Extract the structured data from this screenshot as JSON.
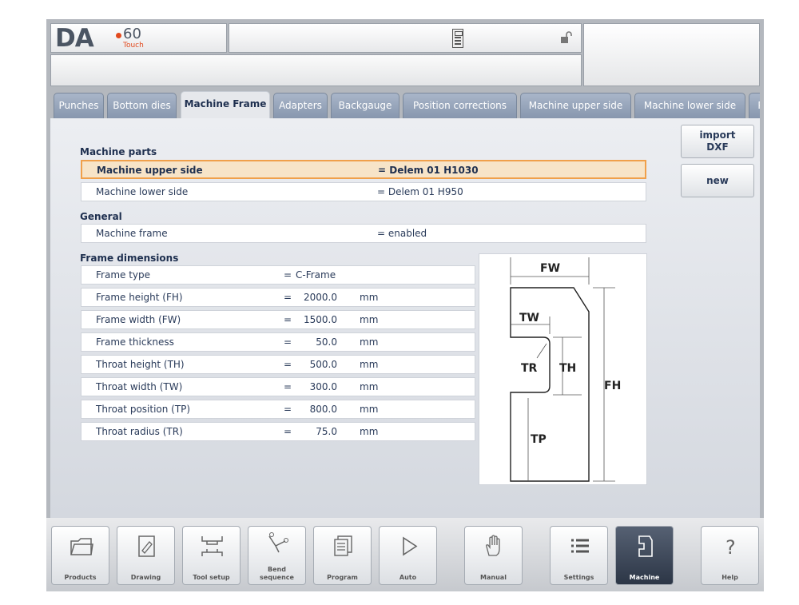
{
  "header": {
    "logo_text": "DA",
    "logo_model": "60",
    "logo_sub": "Touch"
  },
  "tabs": [
    {
      "label": "Punches"
    },
    {
      "label": "Bottom dies"
    },
    {
      "label": "Machine Frame",
      "active": true
    },
    {
      "label": "Adapters"
    },
    {
      "label": "Backgauge"
    },
    {
      "label": "Position corrections"
    },
    {
      "label": "Machine upper side"
    },
    {
      "label": "Machine lower side"
    },
    {
      "label": "P"
    }
  ],
  "sections": {
    "machine_parts": {
      "title": "Machine parts",
      "rows": [
        {
          "label": "Machine upper side",
          "value": "= Delem 01 H1030"
        },
        {
          "label": "Machine lower side",
          "value": "= Delem 01 H950"
        }
      ]
    },
    "general": {
      "title": "General",
      "rows": [
        {
          "label": "Machine frame",
          "value": "= enabled"
        }
      ]
    },
    "frame_dimensions": {
      "title": "Frame dimensions",
      "frame_type": {
        "label": "Frame type",
        "eq": "=",
        "value": "C-Frame"
      },
      "rows": [
        {
          "label": "Frame height (FH)",
          "eq": "=",
          "value": "2000.0",
          "unit": "mm"
        },
        {
          "label": "Frame width (FW)",
          "eq": "=",
          "value": "1500.0",
          "unit": "mm"
        },
        {
          "label": "Frame thickness",
          "eq": "=",
          "value": "50.0",
          "unit": "mm"
        },
        {
          "label": "Throat height (TH)",
          "eq": "=",
          "value": "500.0",
          "unit": "mm"
        },
        {
          "label": "Throat width (TW)",
          "eq": "=",
          "value": "300.0",
          "unit": "mm"
        },
        {
          "label": "Throat position (TP)",
          "eq": "=",
          "value": "800.0",
          "unit": "mm"
        },
        {
          "label": "Throat radius (TR)",
          "eq": "=",
          "value": "75.0",
          "unit": "mm"
        }
      ]
    }
  },
  "side_buttons": {
    "import": "import\nDXF",
    "new": "new"
  },
  "diagram_labels": {
    "fw": "FW",
    "tw": "TW",
    "tr": "TR",
    "th": "TH",
    "fh": "FH",
    "tp": "TP"
  },
  "nav": [
    {
      "label": "Products",
      "icon": "folder-icon"
    },
    {
      "label": "Drawing",
      "icon": "drawing-icon"
    },
    {
      "label": "Tool setup",
      "icon": "tool-setup-icon"
    },
    {
      "label": "Bend\nsequence",
      "icon": "bend-sequence-icon"
    },
    {
      "label": "Program",
      "icon": "program-icon"
    },
    {
      "label": "Auto",
      "icon": "play-icon"
    },
    {
      "label": "Manual",
      "icon": "hand-icon"
    },
    {
      "label": "Settings",
      "icon": "settings-list-icon"
    },
    {
      "label": "Machine",
      "icon": "machine-icon",
      "active": true
    },
    {
      "label": "Help",
      "icon": "help-icon"
    }
  ],
  "colors": {
    "accent_orange": "#f0a04b",
    "selected_row": "#f7e4c8",
    "tab_inactive": "#8797ae",
    "text_dark": "#1e2f4f",
    "logo_red": "#e24a1e"
  }
}
